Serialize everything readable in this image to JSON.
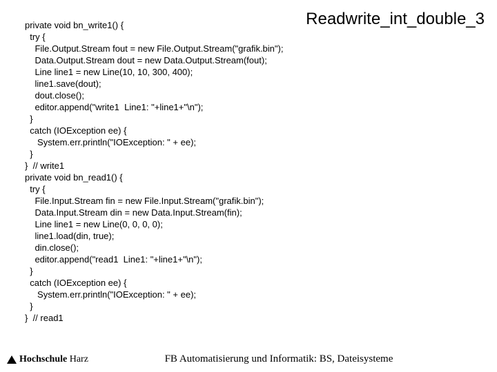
{
  "title": "Readwrite_int_double_3",
  "code": "private void bn_write1() {\n  try {\n    File.Output.Stream fout = new File.Output.Stream(\"grafik.bin\");\n    Data.Output.Stream dout = new Data.Output.Stream(fout);\n    Line line1 = new Line(10, 10, 300, 400);\n    line1.save(dout);\n    dout.close();\n    editor.append(\"write1  Line1: \"+line1+\"\\n\");\n  }\n  catch (IOException ee) {\n     System.err.println(\"IOException: \" + ee);\n  }\n}  // write1\nprivate void bn_read1() {\n  try {\n    File.Input.Stream fin = new File.Input.Stream(\"grafik.bin\");\n    Data.Input.Stream din = new Data.Input.Stream(fin);\n    Line line1 = new Line(0, 0, 0, 0);\n    line1.load(din, true);\n    din.close();\n    editor.append(\"read1  Line1: \"+line1+\"\\n\");\n  }\n  catch (IOException ee) {\n     System.err.println(\"IOException: \" + ee);\n  }\n}  // read1",
  "footer": {
    "logo_bold": "Hochschule",
    "logo_plain": "Harz",
    "text": "FB Automatisierung und Informatik: BS, Dateisysteme"
  }
}
